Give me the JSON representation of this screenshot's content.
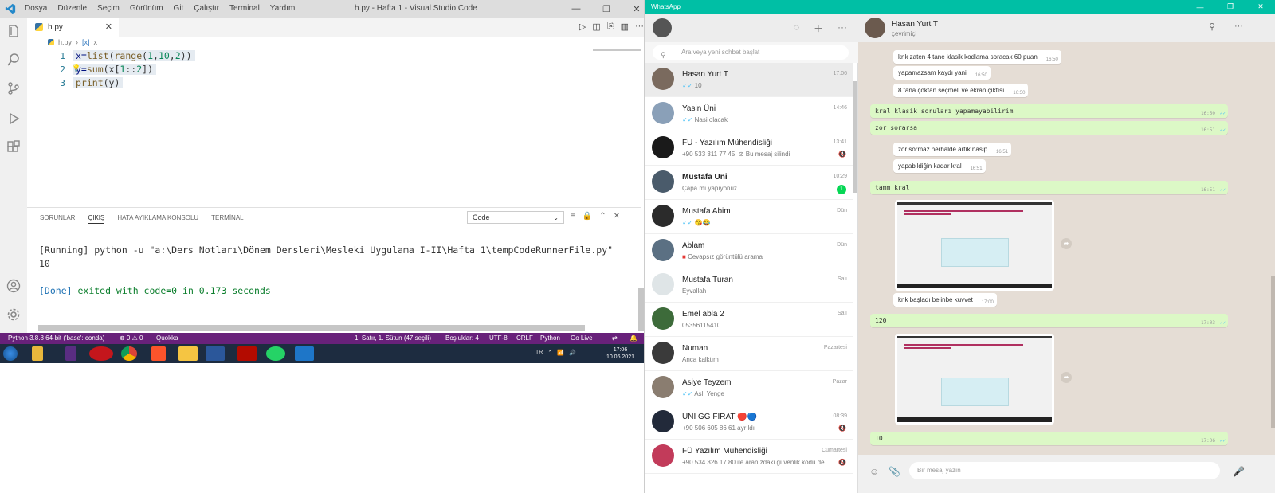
{
  "vscode": {
    "menu": [
      "Dosya",
      "Düzenle",
      "Seçim",
      "Görünüm",
      "Git",
      "Çalıştır",
      "Terminal",
      "Yardım"
    ],
    "window_title": "h.py - Hafta 1 - Visual Studio Code",
    "tab": "h.py",
    "breadcrumb": {
      "file": "h.py",
      "symbol": "x"
    },
    "code": {
      "line_numbers": [
        "1",
        "2",
        "3"
      ],
      "l1": {
        "a": "x=",
        "b": "list",
        "c": "(",
        "d": "range",
        "e": "(",
        "f": "1",
        "g": ",",
        "h": "10",
        "i": ",",
        "j": "2",
        "k": "))"
      },
      "l2": {
        "a": "y=",
        "b": "sum",
        "c": "(x[",
        "d": "1",
        "e": "::",
        "f": "2",
        "g": "])"
      },
      "l3": {
        "a": "print",
        "b": "(y)"
      }
    },
    "panel_tabs": [
      "SORUNLAR",
      "ÇIKIŞ",
      "HATA AYIKLAMA KONSOLU",
      "TERMİNAL"
    ],
    "panel_select": "Code",
    "output": {
      "running": "[Running] python -u \"a:\\Ders Notları\\Dönem Dersleri\\Mesleki Uygulama I-II\\Hafta 1\\tempCodeRunnerFile.py\"",
      "result": "10",
      "done_bracket": "[Done]",
      "done_text": " exited with code=0 in 0.173 seconds"
    },
    "status": {
      "interpreter": "Python 3.8.8 64-bit ('base': conda)",
      "problems": "⊗ 0  ⚠ 0",
      "quokka": "Quokka",
      "position": "1. Satır, 1. Sütun (47 seçili)",
      "spaces": "Boşluklar: 4",
      "encoding": "UTF-8",
      "eol": "CRLF",
      "lang": "Python",
      "golive": "Go Live"
    },
    "taskbar": {
      "lang": "TR",
      "time": "17:06",
      "date": "10.06.2021"
    }
  },
  "whatsapp": {
    "app_title": "WhatsApp",
    "search_placeholder": "Ara veya yeni sohbet başlat",
    "chats": [
      {
        "name": "Hasan Yurt T",
        "preview": "10",
        "time": "17:06",
        "color": "#7a6a5e"
      },
      {
        "name": "Yasin Üni",
        "preview": "Nasi olacak",
        "time": "14:46",
        "color": "#8aa0b8"
      },
      {
        "name": "FÜ - Yazılım Mühendisliği",
        "preview": "+90 533 311 77 45: ⊘ Bu mesaj silindi",
        "time": "13:41",
        "color": "#1a1a1a"
      },
      {
        "name": "Mustafa Uni",
        "preview": "Çapa mı yapıyonuz",
        "time": "10:29",
        "badge": "1",
        "color": "#4a5b6b"
      },
      {
        "name": "Mustafa Abim",
        "preview": "😘😂",
        "time": "Dün",
        "color": "#2b2b2b"
      },
      {
        "name": "Ablam",
        "preview": "Cevapsız görüntülü arama",
        "time": "Dün",
        "color": "#5b7083"
      },
      {
        "name": "Mustafa Turan",
        "preview": "Eyvallah",
        "time": "Salı",
        "color": "#dfe5e7"
      },
      {
        "name": "Emel abla 2",
        "preview": "05356115410",
        "time": "Salı",
        "color": "#3d6b3a"
      },
      {
        "name": "Numan",
        "preview": "Anca kalktım",
        "time": "Pazartesi",
        "color": "#3a3a3a"
      },
      {
        "name": "Asiye Teyzem",
        "preview": "Aslı Yenge",
        "time": "Pazar",
        "color": "#8a7d70"
      },
      {
        "name": "ÜNİ GG FIRAT 🔴🔵",
        "preview": "+90 506 605 86 61 ayrıldı",
        "time": "08:39",
        "color": "#222a3a"
      },
      {
        "name": "FÜ Yazılım Mühendisliği",
        "preview": "+90 534 326 17 80 ile aranızdaki güvenlik kodu de...",
        "time": "Cumartesi",
        "color": "#c23b5a"
      }
    ],
    "contact": {
      "name": "Hasan Yurt T",
      "status": "çevrimiçi"
    },
    "messages": [
      {
        "text": "knk zaten 4 tane klasik kodlama soracak 60 puan",
        "time": "16:50",
        "out": false
      },
      {
        "text": "yapamazsam kaydı yani",
        "time": "16:50",
        "out": false
      },
      {
        "text": "8 tana çoktan seçmeli ve ekran çıktısı",
        "time": "16:50",
        "out": false
      },
      {
        "text": "kral klasik soruları yapamayabilirim",
        "time": "16:50",
        "out": true
      },
      {
        "text": "zor sorarsa",
        "time": "16:51",
        "out": true
      },
      {
        "text": "zor sormaz herhalde artık nasip",
        "time": "16:51",
        "out": false
      },
      {
        "text": "yapabildiğin kadar kral",
        "time": "16:51",
        "out": false
      },
      {
        "text": "tamm kral",
        "time": "16:51",
        "out": true
      },
      {
        "text": "knk başladı belinbe kuvvet",
        "time": "17:00",
        "out": false
      },
      {
        "text": "120",
        "time": "17:03",
        "out": true
      },
      {
        "text": "10",
        "time": "17:06",
        "out": true
      }
    ],
    "compose_placeholder": "Bir mesaj yazın"
  }
}
